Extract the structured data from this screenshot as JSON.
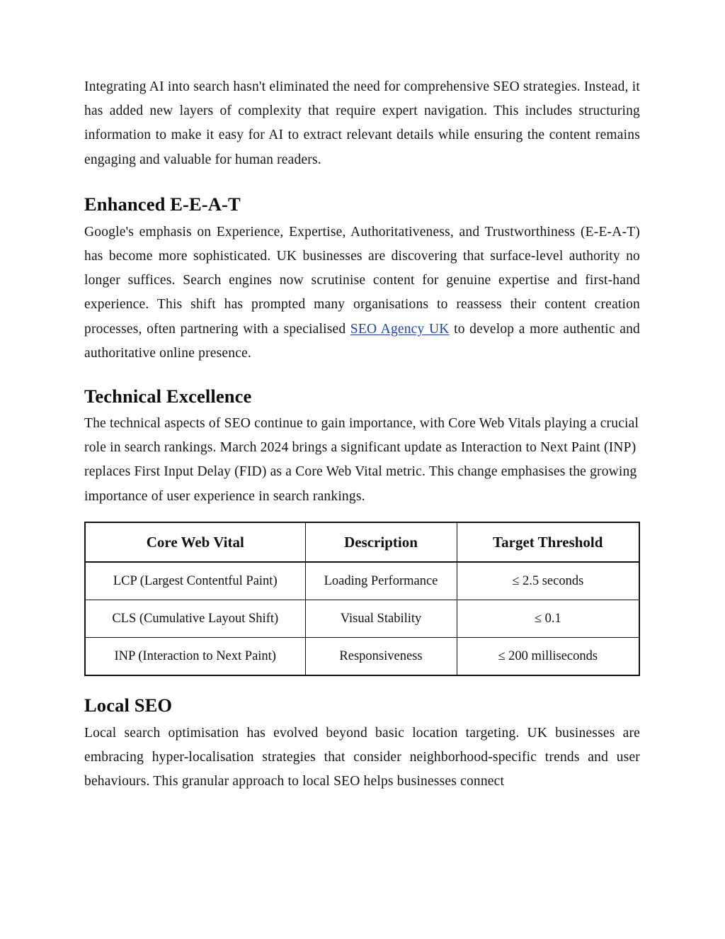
{
  "document": {
    "sections": [
      {
        "type": "paragraph",
        "name": "intro-paragraph",
        "text": "Integrating AI into search hasn't eliminated the need for comprehensive SEO strategies. Instead, it has added new layers of complexity that require expert navigation. This includes structuring information to make it easy for AI to extract relevant details while ensuring the content remains engaging and valuable for human readers."
      },
      {
        "type": "heading",
        "name": "heading-enhanced-eeat",
        "text": "Enhanced E-E-A-T"
      },
      {
        "type": "paragraph-with-link",
        "name": "eeat-paragraph",
        "text_before_link": "Google's emphasis on Experience, Expertise, Authoritativeness, and Trustworthiness (E-E-A-T) has become more sophisticated. UK businesses are discovering that surface-level authority no longer suffices. Search engines now scrutinise content for genuine expertise and first-hand experience. This shift has prompted many organisations to reassess their content creation processes, often partnering with a specialised ",
        "link_text": "SEO Agency UK",
        "text_after_link": " to develop a more authentic and authoritative online presence."
      },
      {
        "type": "heading",
        "name": "heading-technical-excellence",
        "text": "Technical Excellence"
      },
      {
        "type": "paragraph",
        "name": "technical-paragraph",
        "text": "The technical aspects of SEO continue to gain importance, with Core Web Vitals playing a crucial role in search rankings. March 2024 brings a significant update as Interaction to Next Paint (INP) replaces First Input Delay (FID) as a Core Web Vital metric. This change emphasises the growing importance of user experience in search rankings."
      },
      {
        "type": "heading",
        "name": "heading-local-seo",
        "text": "Local SEO"
      },
      {
        "type": "paragraph",
        "name": "local-seo-paragraph",
        "text": "Local search optimisation has evolved beyond basic location targeting. UK businesses are embracing hyper-localisation strategies that consider neighborhood-specific trends and user behaviours. This granular approach to local SEO helps businesses connect"
      }
    ]
  },
  "core_web_vitals_table": {
    "headers": [
      "Core Web Vital",
      "Description",
      "Target Threshold"
    ],
    "rows": [
      {
        "vital": "LCP (Largest Contentful Paint)",
        "description": "Loading Performance",
        "threshold": "≤ 2.5 seconds"
      },
      {
        "vital": "CLS (Cumulative Layout Shift)",
        "description": "Visual Stability",
        "threshold": "≤ 0.1"
      },
      {
        "vital": "INP (Interaction to Next Paint)",
        "description": "Responsiveness",
        "threshold": "≤ 200 milliseconds"
      }
    ]
  },
  "colors": {
    "page_background": "#ffffff",
    "body_text": "#141414",
    "heading_text": "#0d0d0d",
    "link": "#1a3fc4",
    "table_border": "#111111"
  }
}
